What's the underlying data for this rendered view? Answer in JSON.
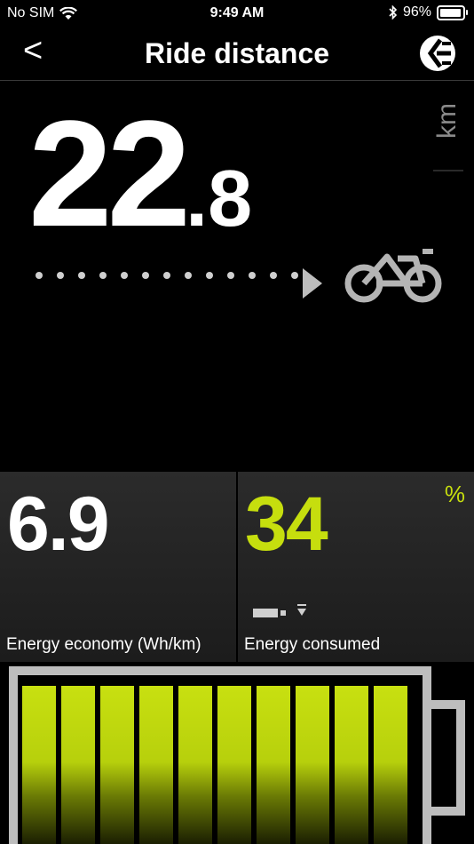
{
  "status": {
    "carrier": "No SIM",
    "time": "9:49 AM",
    "battery_percent": "96%",
    "battery_level": 0.96
  },
  "nav": {
    "back_label": "<",
    "title": "Ride distance"
  },
  "distance": {
    "integer": "22",
    "decimal": ".8",
    "unit": "km",
    "dot_count": 13
  },
  "stats": {
    "economy": {
      "value": "6.9",
      "label": "Energy economy (Wh/km)"
    },
    "consumed": {
      "value": "34",
      "unit": "%",
      "label": "Energy consumed"
    }
  },
  "battery": {
    "bars_filled": 10,
    "bars_total": 10
  },
  "colors": {
    "accent": "#c6de0e",
    "background": "#000000",
    "panel": "#262626",
    "outline": "#bdbdbd"
  },
  "icons": {
    "wifi": "wifi-icon",
    "bluetooth": "bluetooth-icon",
    "brand": "brand-logo-icon",
    "bike": "bike-icon",
    "arrow": "arrow-right-icon",
    "battery_plug": "battery-plug-icon"
  }
}
